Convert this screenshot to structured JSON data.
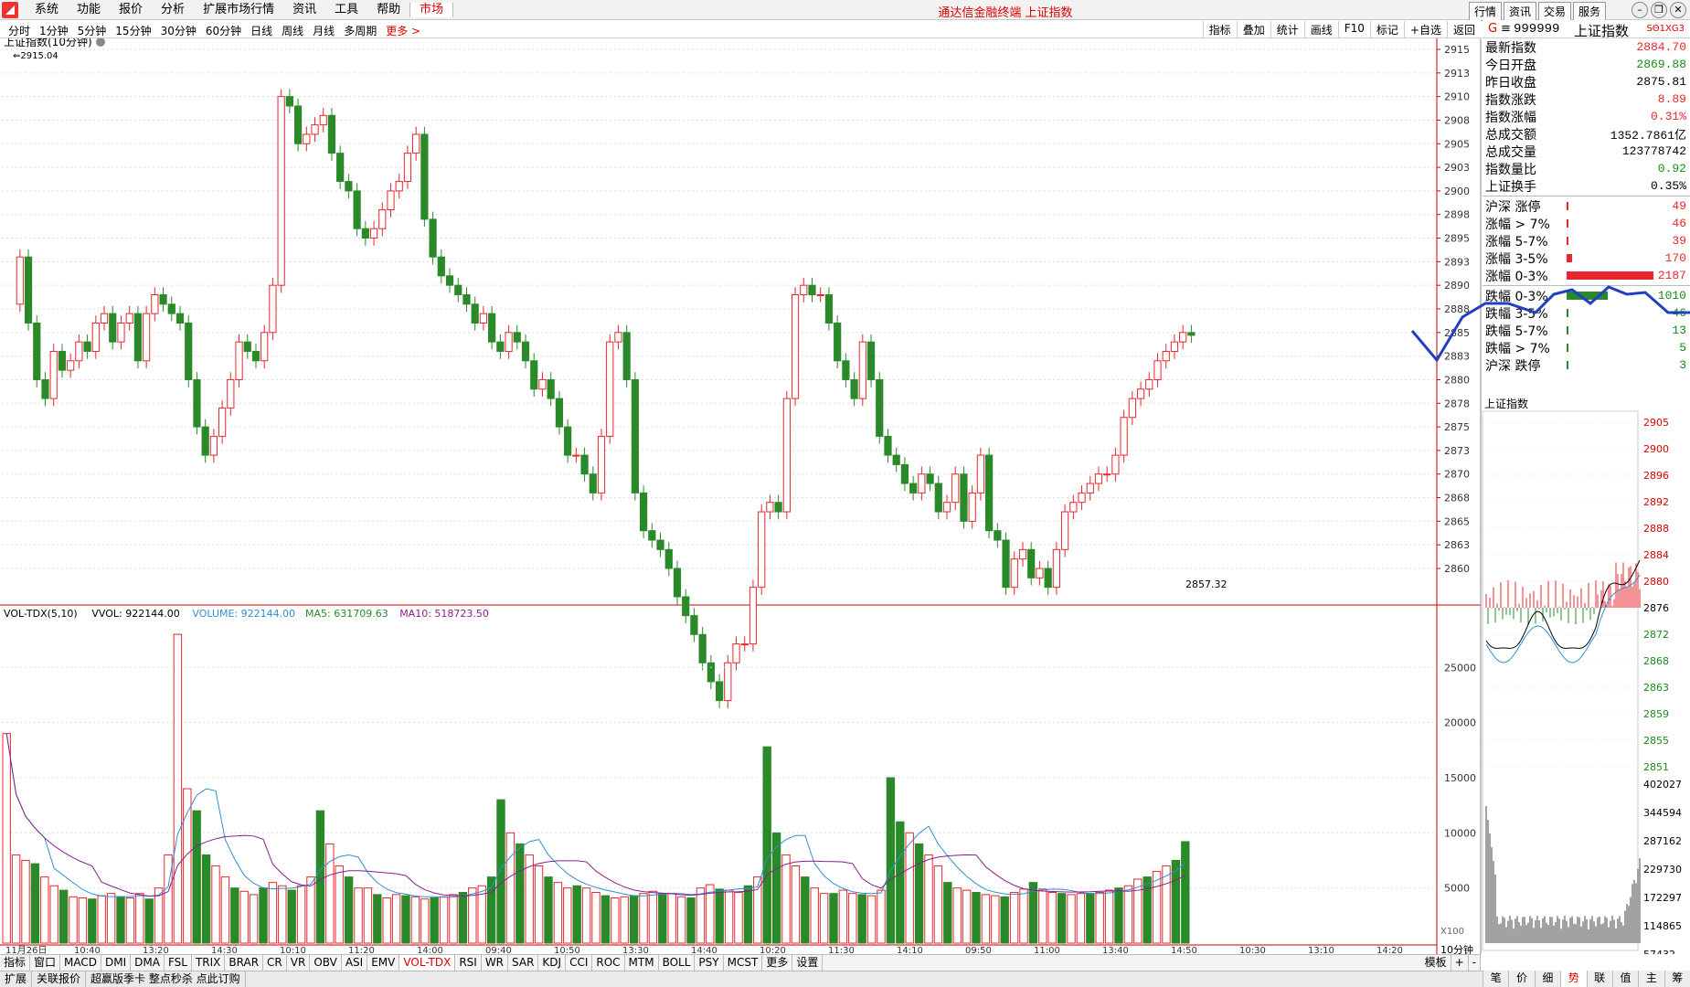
{
  "menubar": {
    "items": [
      "系统",
      "功能",
      "报价",
      "分析",
      "扩展市场行情",
      "资讯",
      "工具",
      "帮助",
      "市场"
    ],
    "title": "通达信金融终端 上证指数",
    "right_buttons": [
      "行情",
      "资讯",
      "交易",
      "服务"
    ]
  },
  "periods": [
    "分时",
    "1分钟",
    "5分钟",
    "15分钟",
    "30分钟",
    "60分钟",
    "日线",
    "周线",
    "月线",
    "多周期",
    "更多 >"
  ],
  "tools": [
    "指标",
    "叠加",
    "统计",
    "画线",
    "F10",
    "标记",
    "+自选",
    "返回"
  ],
  "chart_title": "上证指数(10分钟)",
  "high_label": "2915.04",
  "low_label": "2857.32",
  "price_ticks": [
    "2915",
    "2913",
    "2910",
    "2908",
    "2905",
    "2903",
    "2900",
    "2898",
    "2895",
    "2893",
    "2890",
    "2888",
    "2885",
    "2883",
    "2880",
    "2878",
    "2875",
    "2873",
    "2870",
    "2868",
    "2865",
    "2863",
    "2860"
  ],
  "volume_header": {
    "name": "VOL-TDX(5,10)",
    "vvol": "VVOL: 922144.00",
    "volume": "VOLUME: 922144.00",
    "ma5": "MA5: 631709.63",
    "ma10": "MA10: 518723.50"
  },
  "volume_ticks": [
    "25000",
    "20000",
    "15000",
    "10000",
    "5000"
  ],
  "volume_unit": "X100",
  "time_labels": [
    "11月26日",
    "10:40",
    "13:20",
    "14:30",
    "10:10",
    "11:20",
    "14:00",
    "09:40",
    "10:50",
    "13:30",
    "14:40",
    "10:20",
    "11:30",
    "14:10",
    "09:50",
    "11:00",
    "13:40",
    "14:50",
    "10:30",
    "13:10",
    "14:20"
  ],
  "period_label": "10分钟",
  "quote": {
    "header": {
      "code": "999999",
      "name": "上证指数",
      "tag": "G",
      "extra": "SΘ1XG3"
    },
    "rows": [
      {
        "label": "最新指数",
        "value": "2884.70",
        "color": "red"
      },
      {
        "label": "今日开盘",
        "value": "2869.88",
        "color": "green"
      },
      {
        "label": "昨日收盘",
        "value": "2875.81",
        "color": "black"
      },
      {
        "label": "指数涨跌",
        "value": "8.89",
        "color": "red"
      },
      {
        "label": "指数涨幅",
        "value": "0.31%",
        "color": "red"
      },
      {
        "label": "总成交额",
        "value": "1352.7861亿",
        "color": "black"
      },
      {
        "label": "总成交量",
        "value": "123778742",
        "color": "black"
      },
      {
        "label": "指数量比",
        "value": "0.92",
        "color": "green"
      },
      {
        "label": "上证换手",
        "value": "0.35%",
        "color": "black"
      }
    ],
    "up_rows": [
      {
        "label": "沪深 涨停",
        "value": "49",
        "bar": 0.005
      },
      {
        "label": "涨幅 > 7%",
        "value": "46",
        "bar": 0.005
      },
      {
        "label": "涨幅 5-7%",
        "value": "39",
        "bar": 0.005
      },
      {
        "label": "涨幅 3-5%",
        "value": "170",
        "bar": 0.06
      },
      {
        "label": "涨幅 0-3%",
        "value": "2187",
        "bar": 0.95
      }
    ],
    "down_rows": [
      {
        "label": "跌幅 0-3%",
        "value": "1010",
        "bar": 0.45
      },
      {
        "label": "跌幅 3-5%",
        "value": "46",
        "bar": 0.005
      },
      {
        "label": "跌幅 5-7%",
        "value": "13",
        "bar": 0.005
      },
      {
        "label": "跌幅 > 7%",
        "value": "5",
        "bar": 0.005
      },
      {
        "label": "沪深 跌停",
        "value": "3",
        "bar": 0.005
      }
    ]
  },
  "mini_chart": {
    "title": "上证指数",
    "price_ticks": [
      "2905",
      "2900",
      "2896",
      "2892",
      "2888",
      "2884",
      "2880",
      "2876",
      "2872",
      "2868",
      "2863",
      "2859",
      "2855",
      "2851"
    ],
    "vol_ticks": [
      "402027",
      "344594",
      "287162",
      "229730",
      "172297",
      "114865",
      "57432"
    ]
  },
  "bottom_tabs": [
    "指标",
    "窗口",
    "MACD",
    "DMI",
    "DMA",
    "FSL",
    "TRIX",
    "BRAR",
    "CR",
    "VR",
    "OBV",
    "ASI",
    "EMV",
    "VOL-TDX",
    "RSI",
    "WR",
    "SAR",
    "KDJ",
    "CCI",
    "ROC",
    "MTM",
    "BOLL",
    "PSY",
    "MCST",
    "更多",
    "设置"
  ],
  "bottom_right": [
    "模板",
    "+",
    "-"
  ],
  "status_items": [
    "扩展",
    "关联报价",
    "超赢版季卡 整点秒杀 点此订购"
  ],
  "right_tabs": [
    "笔",
    "价",
    "细",
    "势",
    "联",
    "值",
    "主",
    "筹"
  ],
  "colors": {
    "up": "#e8262d",
    "down": "#2a8a2a",
    "ma5": "#2f8fd0",
    "ma10": "#8b1e8b",
    "blue_line": "#2140c0"
  }
}
